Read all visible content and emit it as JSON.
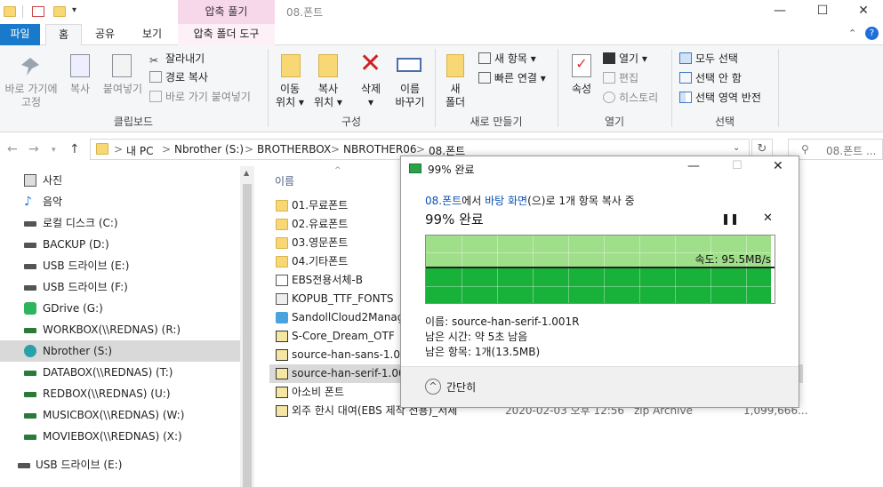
{
  "window": {
    "title": "08.폰트",
    "context_header": "압축 풀기",
    "controls": [
      "—",
      "☐",
      "✕"
    ]
  },
  "tabs": {
    "file": "파일",
    "home": "홈",
    "share": "공유",
    "view": "보기",
    "context_tool": "압축 폴더 도구"
  },
  "ribbon": {
    "clipboard": {
      "pin": "바로 가기에\n고정",
      "copy": "복사",
      "paste": "붙여넣기",
      "cut": "잘라내기",
      "copy_path": "경로 복사",
      "paste_shortcut": "바로 가기 붙여넣기",
      "group": "클립보드"
    },
    "organize": {
      "move_to": [
        "이동",
        "위치 ▾"
      ],
      "copy_to": [
        "복사",
        "위치 ▾"
      ],
      "delete": [
        "삭제",
        "▾"
      ],
      "rename": [
        "이름",
        "바꾸기"
      ],
      "group": "구성"
    },
    "new": {
      "new_folder": [
        "새",
        "폴더"
      ],
      "new_item": "새 항목 ▾",
      "easy_access": "빠른 연결 ▾",
      "group": "새로 만들기"
    },
    "open": {
      "properties": "속성",
      "open": "열기 ▾",
      "edit": "편집",
      "history": "히스토리",
      "group": "열기"
    },
    "select": {
      "select_all": "모두 선택",
      "select_none": "선택 안 함",
      "invert": "선택 영역 반전",
      "group": "선택"
    }
  },
  "address": {
    "crumbs": [
      "내 PC",
      "Nbrother (S:)",
      "BROTHERBOX",
      "NBROTHER06",
      "08.폰트"
    ],
    "separator": ">",
    "search_placeholder": "08.폰트 ..."
  },
  "nav": [
    {
      "label": "사진",
      "icon": "pictures-icon",
      "selected": false
    },
    {
      "label": "음악",
      "icon": "music-icon",
      "selected": false
    },
    {
      "label": "로컬 디스크 (C:)",
      "icon": "drive-icon",
      "selected": false
    },
    {
      "label": "BACKUP (D:)",
      "icon": "drive-icon",
      "selected": false
    },
    {
      "label": "USB 드라이브 (E:)",
      "icon": "drive-icon",
      "selected": false
    },
    {
      "label": "USB 드라이브 (F:)",
      "icon": "drive-icon",
      "selected": false
    },
    {
      "label": "GDrive (G:)",
      "icon": "gdrive-icon",
      "selected": false
    },
    {
      "label": "WORKBOX(\\\\REDNAS) (R:)",
      "icon": "network-drive-icon",
      "selected": false
    },
    {
      "label": "Nbrother (S:)",
      "icon": "network-drive-icon",
      "selected": true
    },
    {
      "label": "DATABOX(\\\\REDNAS) (T:)",
      "icon": "network-drive-icon",
      "selected": false
    },
    {
      "label": "REDBOX(\\\\REDNAS) (U:)",
      "icon": "network-drive-icon",
      "selected": false
    },
    {
      "label": "MUSICBOX(\\\\REDNAS) (W:)",
      "icon": "network-drive-icon",
      "selected": false
    },
    {
      "label": "MOVIEBOX(\\\\REDNAS) (X:)",
      "icon": "network-drive-icon",
      "selected": false
    }
  ],
  "nav_bottom": "USB 드라이브 (E:)",
  "list": {
    "column_name": "이름",
    "rows": [
      {
        "name": "01.무료폰트",
        "icon": "folder-icon"
      },
      {
        "name": "02.유료폰트",
        "icon": "folder-icon"
      },
      {
        "name": "03.영문폰트",
        "icon": "folder-icon"
      },
      {
        "name": "04.기타폰트",
        "icon": "folder-icon"
      },
      {
        "name": "EBS전용서체-B",
        "icon": "font-file-icon"
      },
      {
        "name": "KOPUB_TTF_FONTS",
        "icon": "installer-icon"
      },
      {
        "name": "SandollCloud2Manage",
        "icon": "app-icon"
      },
      {
        "name": "S-Core_Dream_OTF",
        "icon": "zip-icon"
      },
      {
        "name": "source-han-sans-1.004",
        "icon": "zip-icon"
      },
      {
        "name": "source-han-serif-1.001",
        "icon": "zip-icon",
        "selected": true
      },
      {
        "name": "아소비 폰트",
        "icon": "zip-icon"
      },
      {
        "name": "외주 한시 대여(EBS 제작 전용)_서체",
        "icon": "zip-icon",
        "date": "2020-02-03 오후 12:56",
        "type": "zip Archive",
        "size": "1,099,666..."
      }
    ]
  },
  "dialog": {
    "title": "99% 완료",
    "from_folder": "08.폰트",
    "from_text": "에서 ",
    "to_folder": "바탕 화면",
    "to_text": "(으)로 1개 항목 복사 중",
    "heading": "99% 완료",
    "progress": 0.99,
    "speed": "속도: 95.5MB/s",
    "name": "이름: source-han-serif-1.001R",
    "time_left": "남은 시간: 약 5초 남음",
    "items_left": "남은 항목: 1개(13.5MB)",
    "less_details": "간단히",
    "colors": {
      "graph_done": "#18b13a",
      "graph_bg": "#9fdf8a"
    }
  }
}
